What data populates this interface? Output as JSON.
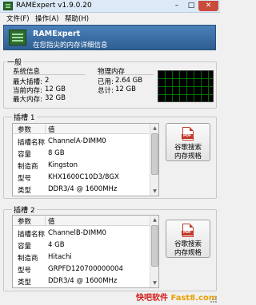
{
  "window": {
    "title": "RAMExpert v1.9.0.20",
    "controls": {
      "minimize": "–",
      "maximize": "□",
      "close": "✕"
    }
  },
  "menu": {
    "items": [
      "文件(F)",
      "操作(A)",
      "帮助(H)"
    ]
  },
  "banner": {
    "title": "RAMExpert",
    "subtitle": "在您指尖的内存详细信息"
  },
  "general": {
    "label": "一般",
    "system_info": {
      "heading": "系统信息",
      "rows": [
        {
          "label": "最大插槽:",
          "value": "2"
        },
        {
          "label": "当前内存:",
          "value": "12 GB"
        },
        {
          "label": "最大内存:",
          "value": "32 GB"
        }
      ]
    },
    "physical_memory": {
      "heading": "物理内存",
      "rows": [
        {
          "label": "已用:",
          "value": "2.64 GB"
        },
        {
          "label": "总计:",
          "value": "12 GB"
        }
      ]
    }
  },
  "slots": [
    {
      "label": "插槽 1",
      "columns": [
        "参数",
        "值"
      ],
      "rows": [
        {
          "param": "插槽名称",
          "value": "ChannelA-DIMM0"
        },
        {
          "param": "容量",
          "value": "8 GB"
        },
        {
          "param": "制造商",
          "value": "Kingston"
        },
        {
          "param": "型号",
          "value": "KHX1600C10D3/8GX"
        },
        {
          "param": "类型",
          "value": "DDR3/4 @ 1600MHz"
        }
      ],
      "spec_button": {
        "icon_text": "PDF",
        "line1": "谷歌搜索",
        "line2": "内存规格"
      }
    },
    {
      "label": "插槽 2",
      "columns": [
        "参数",
        "值"
      ],
      "rows": [
        {
          "param": "插槽名称",
          "value": "ChannelB-DIMM0"
        },
        {
          "param": "容量",
          "value": "4 GB"
        },
        {
          "param": "制造商",
          "value": "Hitachi"
        },
        {
          "param": "型号",
          "value": "GRPFD120700000004"
        },
        {
          "param": "类型",
          "value": "DDR3/4 @ 1600MHz"
        }
      ],
      "spec_button": {
        "icon_text": "PDF",
        "line1": "谷歌搜索",
        "line2": "内存规格"
      }
    }
  ],
  "watermark": {
    "cn": "快吧软件",
    "en": "Fast8.com"
  },
  "colors": {
    "banner": "#3c6ea5",
    "graph_line": "#00c800",
    "close_button": "#c94c3b"
  }
}
